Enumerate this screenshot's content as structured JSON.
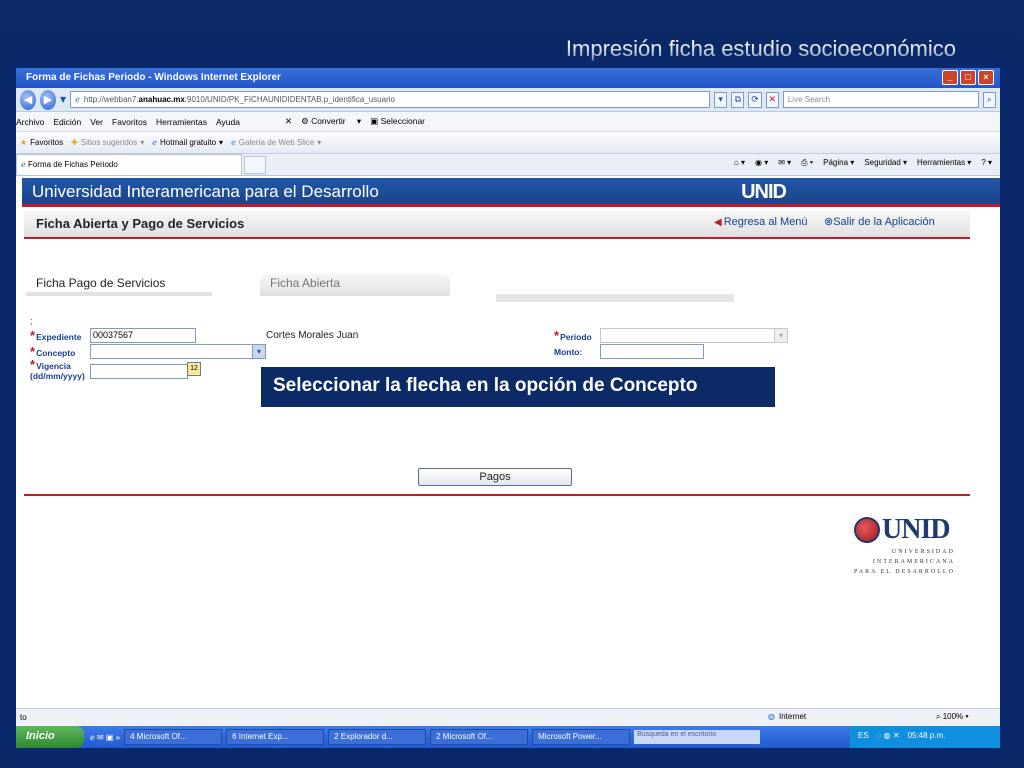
{
  "slide": {
    "title": "Impresión ficha estudio socioeconómico"
  },
  "browser": {
    "window_title": "Forma de Fichas Periodo - Windows Internet Explorer",
    "address_prefix": "http://webban7.",
    "address_domain": "anahuac.mx",
    "address_rest": ":9010/UNID/PK_FICHAUNIDIDENTAB.p_identifica_usuario",
    "search_placeholder": "Live Search",
    "menus": [
      "Archivo",
      "Edición",
      "Ver",
      "Favoritos",
      "Herramientas",
      "Ayuda"
    ],
    "convert_label": "Convertir",
    "select_label": "Seleccionar",
    "favorites_label": "Favoritos",
    "fav_items": [
      "Sitios sugeridos",
      "Hotmail gratuito",
      "Galería de Web Slice"
    ],
    "tab_label": "Forma de Fichas Periodo",
    "cmd_items": [
      "Página",
      "Seguridad",
      "Herramientas"
    ]
  },
  "page": {
    "banner_title": "Universidad Interamericana para el Desarrollo",
    "banner_logo": "UNID",
    "section_title": "Ficha Abierta y Pago de Servicios",
    "back_link": "Regresa al Menú",
    "exit_link": "Salir de la Aplicación",
    "tabs": [
      "Ficha Pago de Servicios",
      "Ficha Abierta"
    ],
    "form": {
      "expediente_label": "Expediente",
      "expediente_value": "00037567",
      "student_name": "Cortes Morales  Juan",
      "periodo_label": "Periodo",
      "concepto_label": "Concepto",
      "monto_label": "Monto:",
      "vigencia_label": "Vigencia",
      "vigencia_format": "(dd/mm/yyyy)",
      "calendar_label": "12",
      "semicolon": ";"
    },
    "callout": "Seleccionar la flecha en la opción de Concepto",
    "submit_label": "Pagos",
    "logo_main": "UNID",
    "logo_sub": [
      "UNIVERSIDAD",
      "INTERAMERICANA",
      "PARA EL DESARROLLO"
    ]
  },
  "status": {
    "left": "to",
    "zone": "Internet",
    "zoom": "100%"
  },
  "taskbar": {
    "start": "Inicio",
    "tasks": [
      "4 Microsoft Of...",
      "6 Internet Exp...",
      "2 Explorador d...",
      "2 Microsoft Of...",
      "Microsoft Power..."
    ],
    "search": "Búsqueda en el escritorio",
    "lang": "ES",
    "clock": "05:48 p.m."
  }
}
